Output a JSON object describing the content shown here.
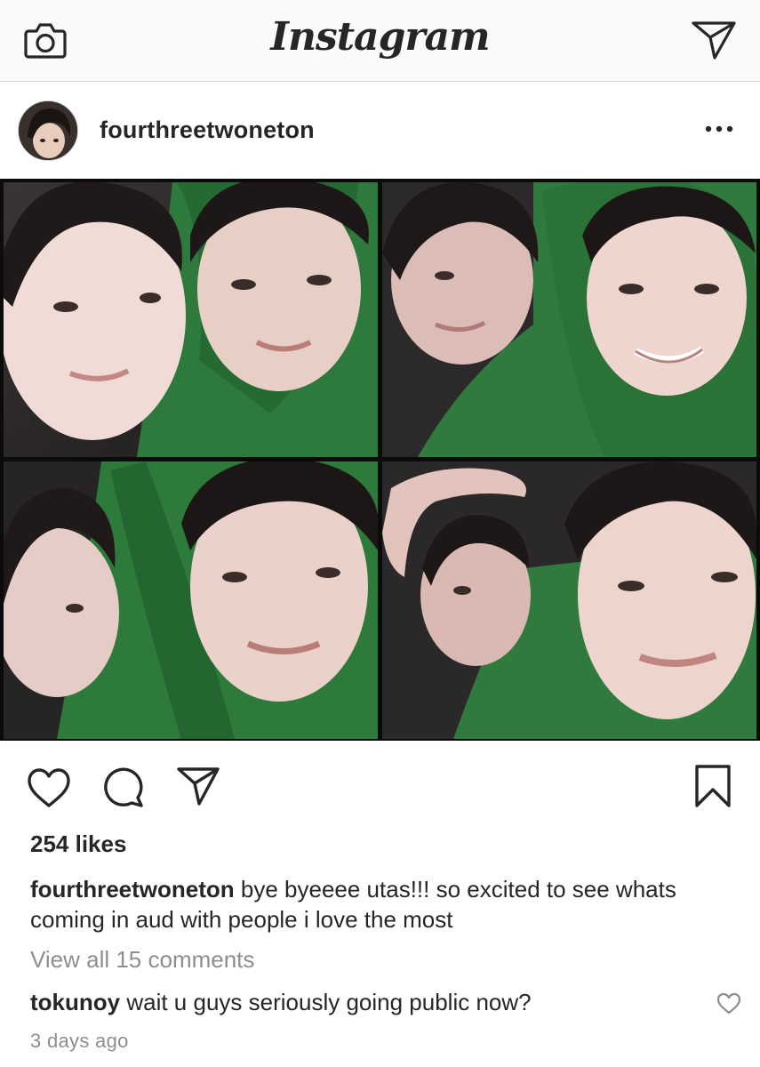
{
  "header": {
    "logo_text": "Instagram",
    "left_icon": "camera-icon",
    "right_icon": "direct-message-icon"
  },
  "post": {
    "username": "fourthreetwoneton",
    "more_icon": "more-options-icon",
    "photo_description_icons": [
      "photo-collage"
    ],
    "actions": {
      "like_icon": "heart-icon",
      "comment_icon": "comment-icon",
      "share_icon": "share-icon",
      "save_icon": "bookmark-icon"
    },
    "likes": "254 likes",
    "caption": {
      "username": "fourthreetwoneton",
      "text": "bye byeeee utas!!! so excited to see whats coming in aud with people i love the most"
    },
    "view_all_comments": "View all 15 comments",
    "comments": [
      {
        "username": "tokunoy",
        "text": "wait u guys seriously going public now?"
      }
    ],
    "timestamp": "3 days ago"
  },
  "colors": {
    "text": "#262626",
    "secondary_text": "#8e8e8e",
    "header_bg": "#fafafa",
    "divider": "#dbdbdb",
    "hoodie_green": "#2f7a3c"
  }
}
